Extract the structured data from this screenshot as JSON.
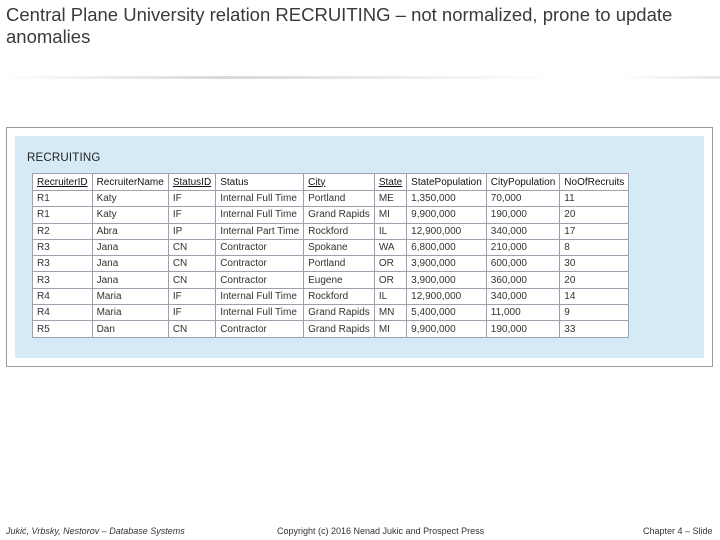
{
  "slide": {
    "title": "Central Plane University relation RECRUITING – not normalized, prone to update anomalies"
  },
  "figure": {
    "caption": "RECRUITING",
    "columns": [
      "RecruiterID",
      "RecruiterName",
      "StatusID",
      "Status",
      "City",
      "State",
      "StatePopulation",
      "CityPopulation",
      "NoOfRecruits"
    ],
    "rows": [
      [
        "R1",
        "Katy",
        "IF",
        "Internal Full Time",
        "Portland",
        "ME",
        "1,350,000",
        "70,000",
        "11"
      ],
      [
        "R1",
        "Katy",
        "IF",
        "Internal Full Time",
        "Grand Rapids",
        "MI",
        "9,900,000",
        "190,000",
        "20"
      ],
      [
        "R2",
        "Abra",
        "IP",
        "Internal Part Time",
        "Rockford",
        "IL",
        "12,900,000",
        "340,000",
        "17"
      ],
      [
        "R3",
        "Jana",
        "CN",
        "Contractor",
        "Spokane",
        "WA",
        "6,800,000",
        "210,000",
        "8"
      ],
      [
        "R3",
        "Jana",
        "CN",
        "Contractor",
        "Portland",
        "OR",
        "3,900,000",
        "600,000",
        "30"
      ],
      [
        "R3",
        "Jana",
        "CN",
        "Contractor",
        "Eugene",
        "OR",
        "3,900,000",
        "360,000",
        "20"
      ],
      [
        "R4",
        "Maria",
        "IF",
        "Internal Full Time",
        "Rockford",
        "IL",
        "12,900,000",
        "340,000",
        "14"
      ],
      [
        "R4",
        "Maria",
        "IF",
        "Internal Full Time",
        "Grand Rapids",
        "MN",
        "5,400,000",
        "11,000",
        "9"
      ],
      [
        "R5",
        "Dan",
        "CN",
        "Contractor",
        "Grand Rapids",
        "MI",
        "9,900,000",
        "190,000",
        "33"
      ]
    ]
  },
  "footer": {
    "authors": "Jukić, Vrbsky, Nestorov – Database Systems",
    "copyright": "Copyright (c) 2016 Nenad Jukic and Prospect Press",
    "slide_label": "Chapter 4 – Slide"
  }
}
